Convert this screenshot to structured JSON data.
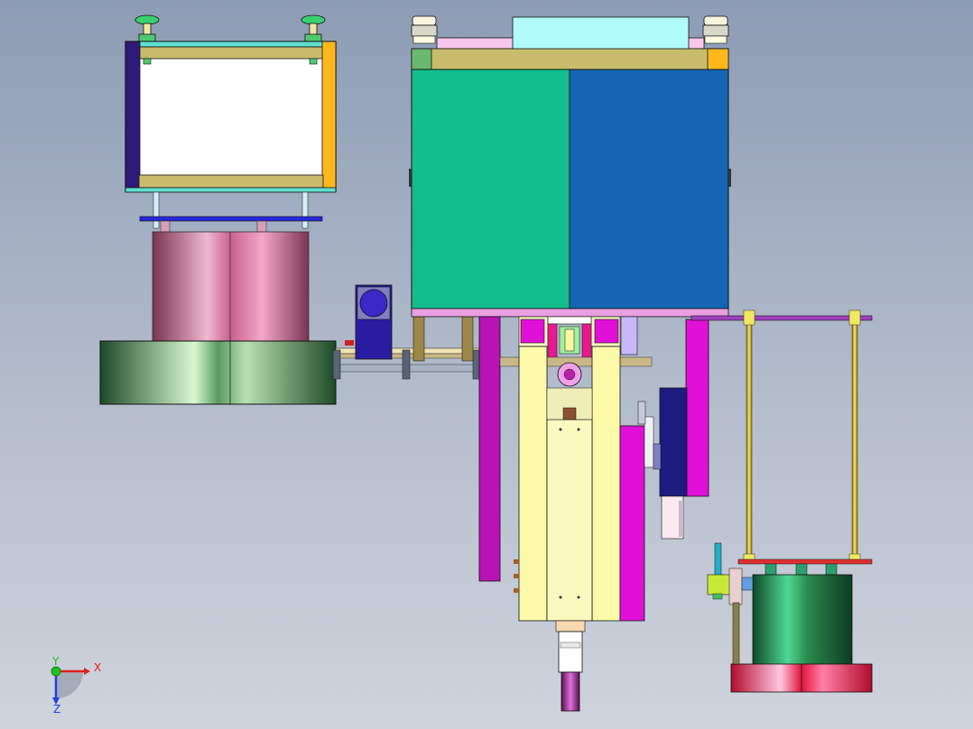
{
  "view": {
    "triad": {
      "x_label": "X",
      "y_label": "Y",
      "z_label": "Z",
      "colors": {
        "x": "#e02020",
        "y": "#20c020",
        "z": "#2040e0"
      }
    }
  },
  "palette": {
    "background_top": "#8c9cb4",
    "background_bottom": "#cfd3dc",
    "frame_olive": "#c8bc6c",
    "frame_navy": "#2e1a78",
    "frame_orange": "#ffb81c",
    "panel_green": "#12be8c",
    "panel_blue": "#1466b4",
    "magenta": "#e010d8",
    "violet": "#b814b4",
    "pale_yellow": "#fafaa8",
    "navy": "#1c1c80",
    "cylinder_pink": "#c86090",
    "cylinder_green": "#2a8a4c",
    "cylinder_red": "#e0143c",
    "rod_yellow": "#e8c828"
  }
}
